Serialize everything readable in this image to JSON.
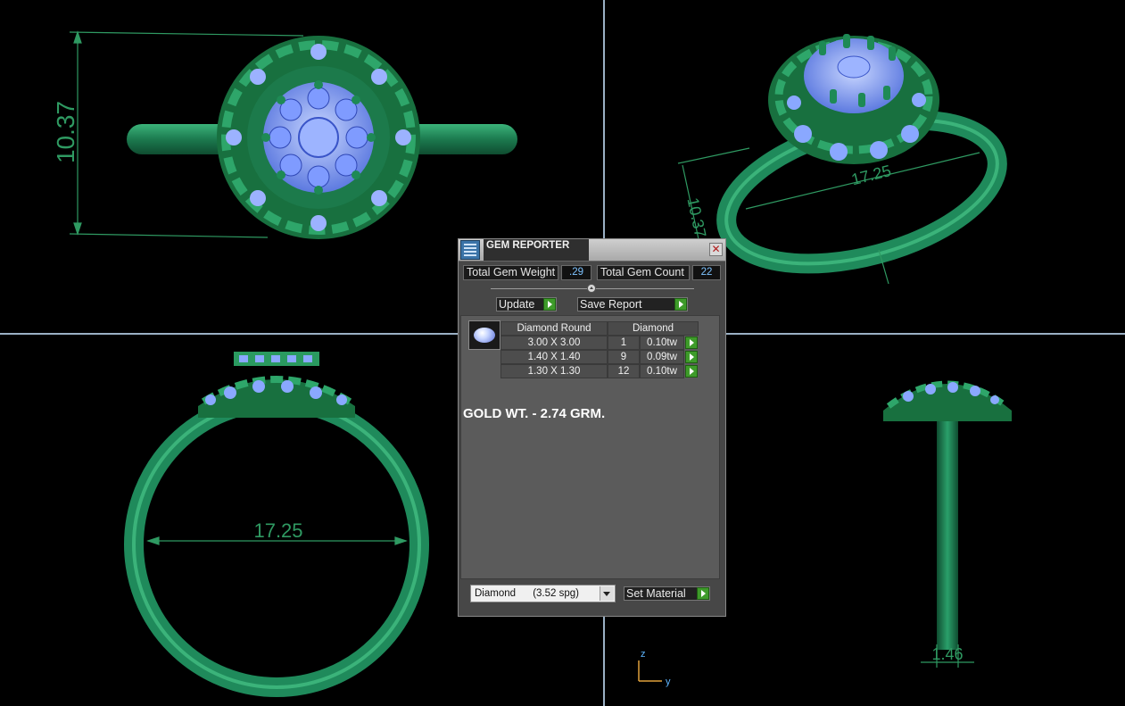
{
  "viewports": {
    "top_left": {
      "dimension_label": "10.37"
    },
    "top_right": {
      "dimension_width": "17.25",
      "dimension_height": "10.37"
    },
    "bottom_left": {
      "dimension_label": "17.25"
    },
    "bottom_right": {
      "dimension_label": "1.46"
    },
    "axis": {
      "z": "z",
      "y": "y"
    }
  },
  "dialog": {
    "title": "GEM REPORTER",
    "close": "✕",
    "total_weight_label": "Total Gem Weight",
    "total_weight_value": ".29",
    "total_count_label": "Total Gem Count",
    "total_count_value": "22",
    "update_label": "Update",
    "save_report_label": "Save Report",
    "table": {
      "headers": [
        "Diamond Round",
        "Diamond"
      ],
      "rows": [
        {
          "size": "3.00 X 3.00",
          "count": "1",
          "weight": "0.10tw"
        },
        {
          "size": "1.40 X 1.40",
          "count": "9",
          "weight": "0.09tw"
        },
        {
          "size": "1.30 X 1.30",
          "count": "12",
          "weight": "0.10tw"
        }
      ]
    },
    "gold_note": "GOLD WT. - 2.74 GRM.",
    "material_select": "Diamond      (3.52 spg)",
    "set_material_label": "Set Material"
  },
  "colors": {
    "ring": "#1f8a5b",
    "gem": "#8aa8ff",
    "dimension": "#2f9a62",
    "divider": "#9ab0c4"
  }
}
